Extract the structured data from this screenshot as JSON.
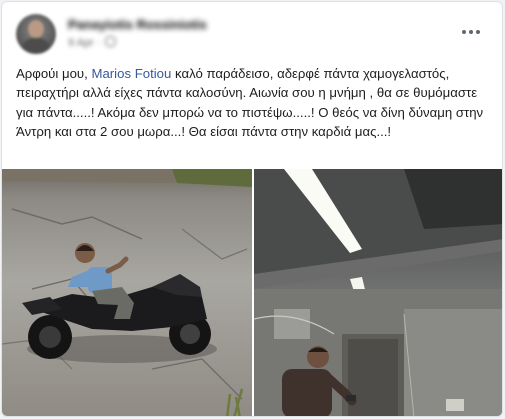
{
  "post": {
    "author_name": "Panayiotis Rossiniotis",
    "meta_time": "9 Apr ·",
    "text_before_mention": "Αρφούι μου, ",
    "mention": "Marios Fotiou",
    "text_after_mention": " καλό παράδεισο, αδερφέ πάντα χαμογελαστός, πειραχτήρι αλλά  είχες πάντα καλοσύνη.  Αιωνία σου η μνήμη , θα σε θυμόμαστε για πάντα.....! Ακόμα δεν μπορώ να το πιστέψω.....! Ο θεός να δίνη δύναμη στην Άντρη και στα 2 σου μωρα...! Θα είσαι πάντα στην καρδιά μας...!"
  },
  "icons": {
    "more": "more-horizontal-icon",
    "privacy": "globe-icon"
  },
  "colors": {
    "link": "#385898",
    "text": "#1c1e21",
    "meta": "#65676b",
    "card": "#ffffff"
  }
}
